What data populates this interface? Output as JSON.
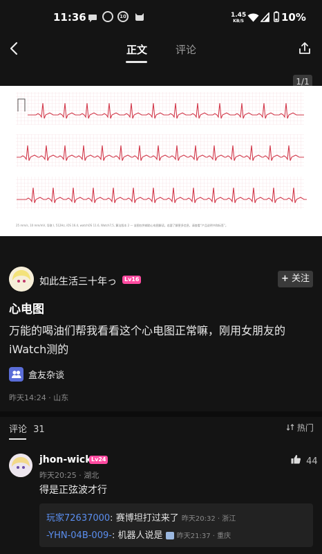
{
  "status_bar": {
    "time": "11:36",
    "notif_badge": "10",
    "net_speed_value": "1.45",
    "net_speed_unit": "KB/S",
    "battery": "10%"
  },
  "nav": {
    "tab_main": "正文",
    "tab_comments": "评论"
  },
  "image": {
    "page_indicator": "1/1",
    "ecg_footer": "25 mm/s, 10 mm/mV, 导联 I, 512Hz, iOS 16.4, watchOS 11.6, Watch7,5, 算法版本 2 — 该图仅供辅助心电图解读。若要了解更多信息，请查看“产品说明书和标签”。"
  },
  "author": {
    "name": "如此生活三十年っ",
    "level": "Lv16",
    "follow_label": "关注"
  },
  "post": {
    "title": "心电图",
    "body": "万能的喝油们帮我看看这个心电图正常嘛，刚用女朋友的iWatch测的",
    "tag": "盒友杂谈",
    "meta": "昨天14:24 · 山东"
  },
  "comments": {
    "header": "评论",
    "count": "31",
    "sort_label": "热门",
    "items": [
      {
        "user": "jhon-wick",
        "level": "Lv24",
        "meta": "昨天20:25 · 湖北",
        "text": "得是正弦波才行",
        "likes": "44",
        "replies": [
          {
            "user": "玩家72637000",
            "sep": ":",
            "text": "赛博坦打过来了",
            "meta": "昨天20:32 · 浙江"
          },
          {
            "user": "-YHN-04B-009-",
            "sep": ":",
            "text": "机器人说是",
            "meta": "昨天21:37 · 重庆"
          }
        ]
      }
    ]
  },
  "colors": {
    "background": "#141414",
    "accent_link": "#5b8ff0",
    "level_badge": "#ff4aa0",
    "ecg_trace": "#d2384a",
    "ecg_grid": "#f3d4d8"
  }
}
